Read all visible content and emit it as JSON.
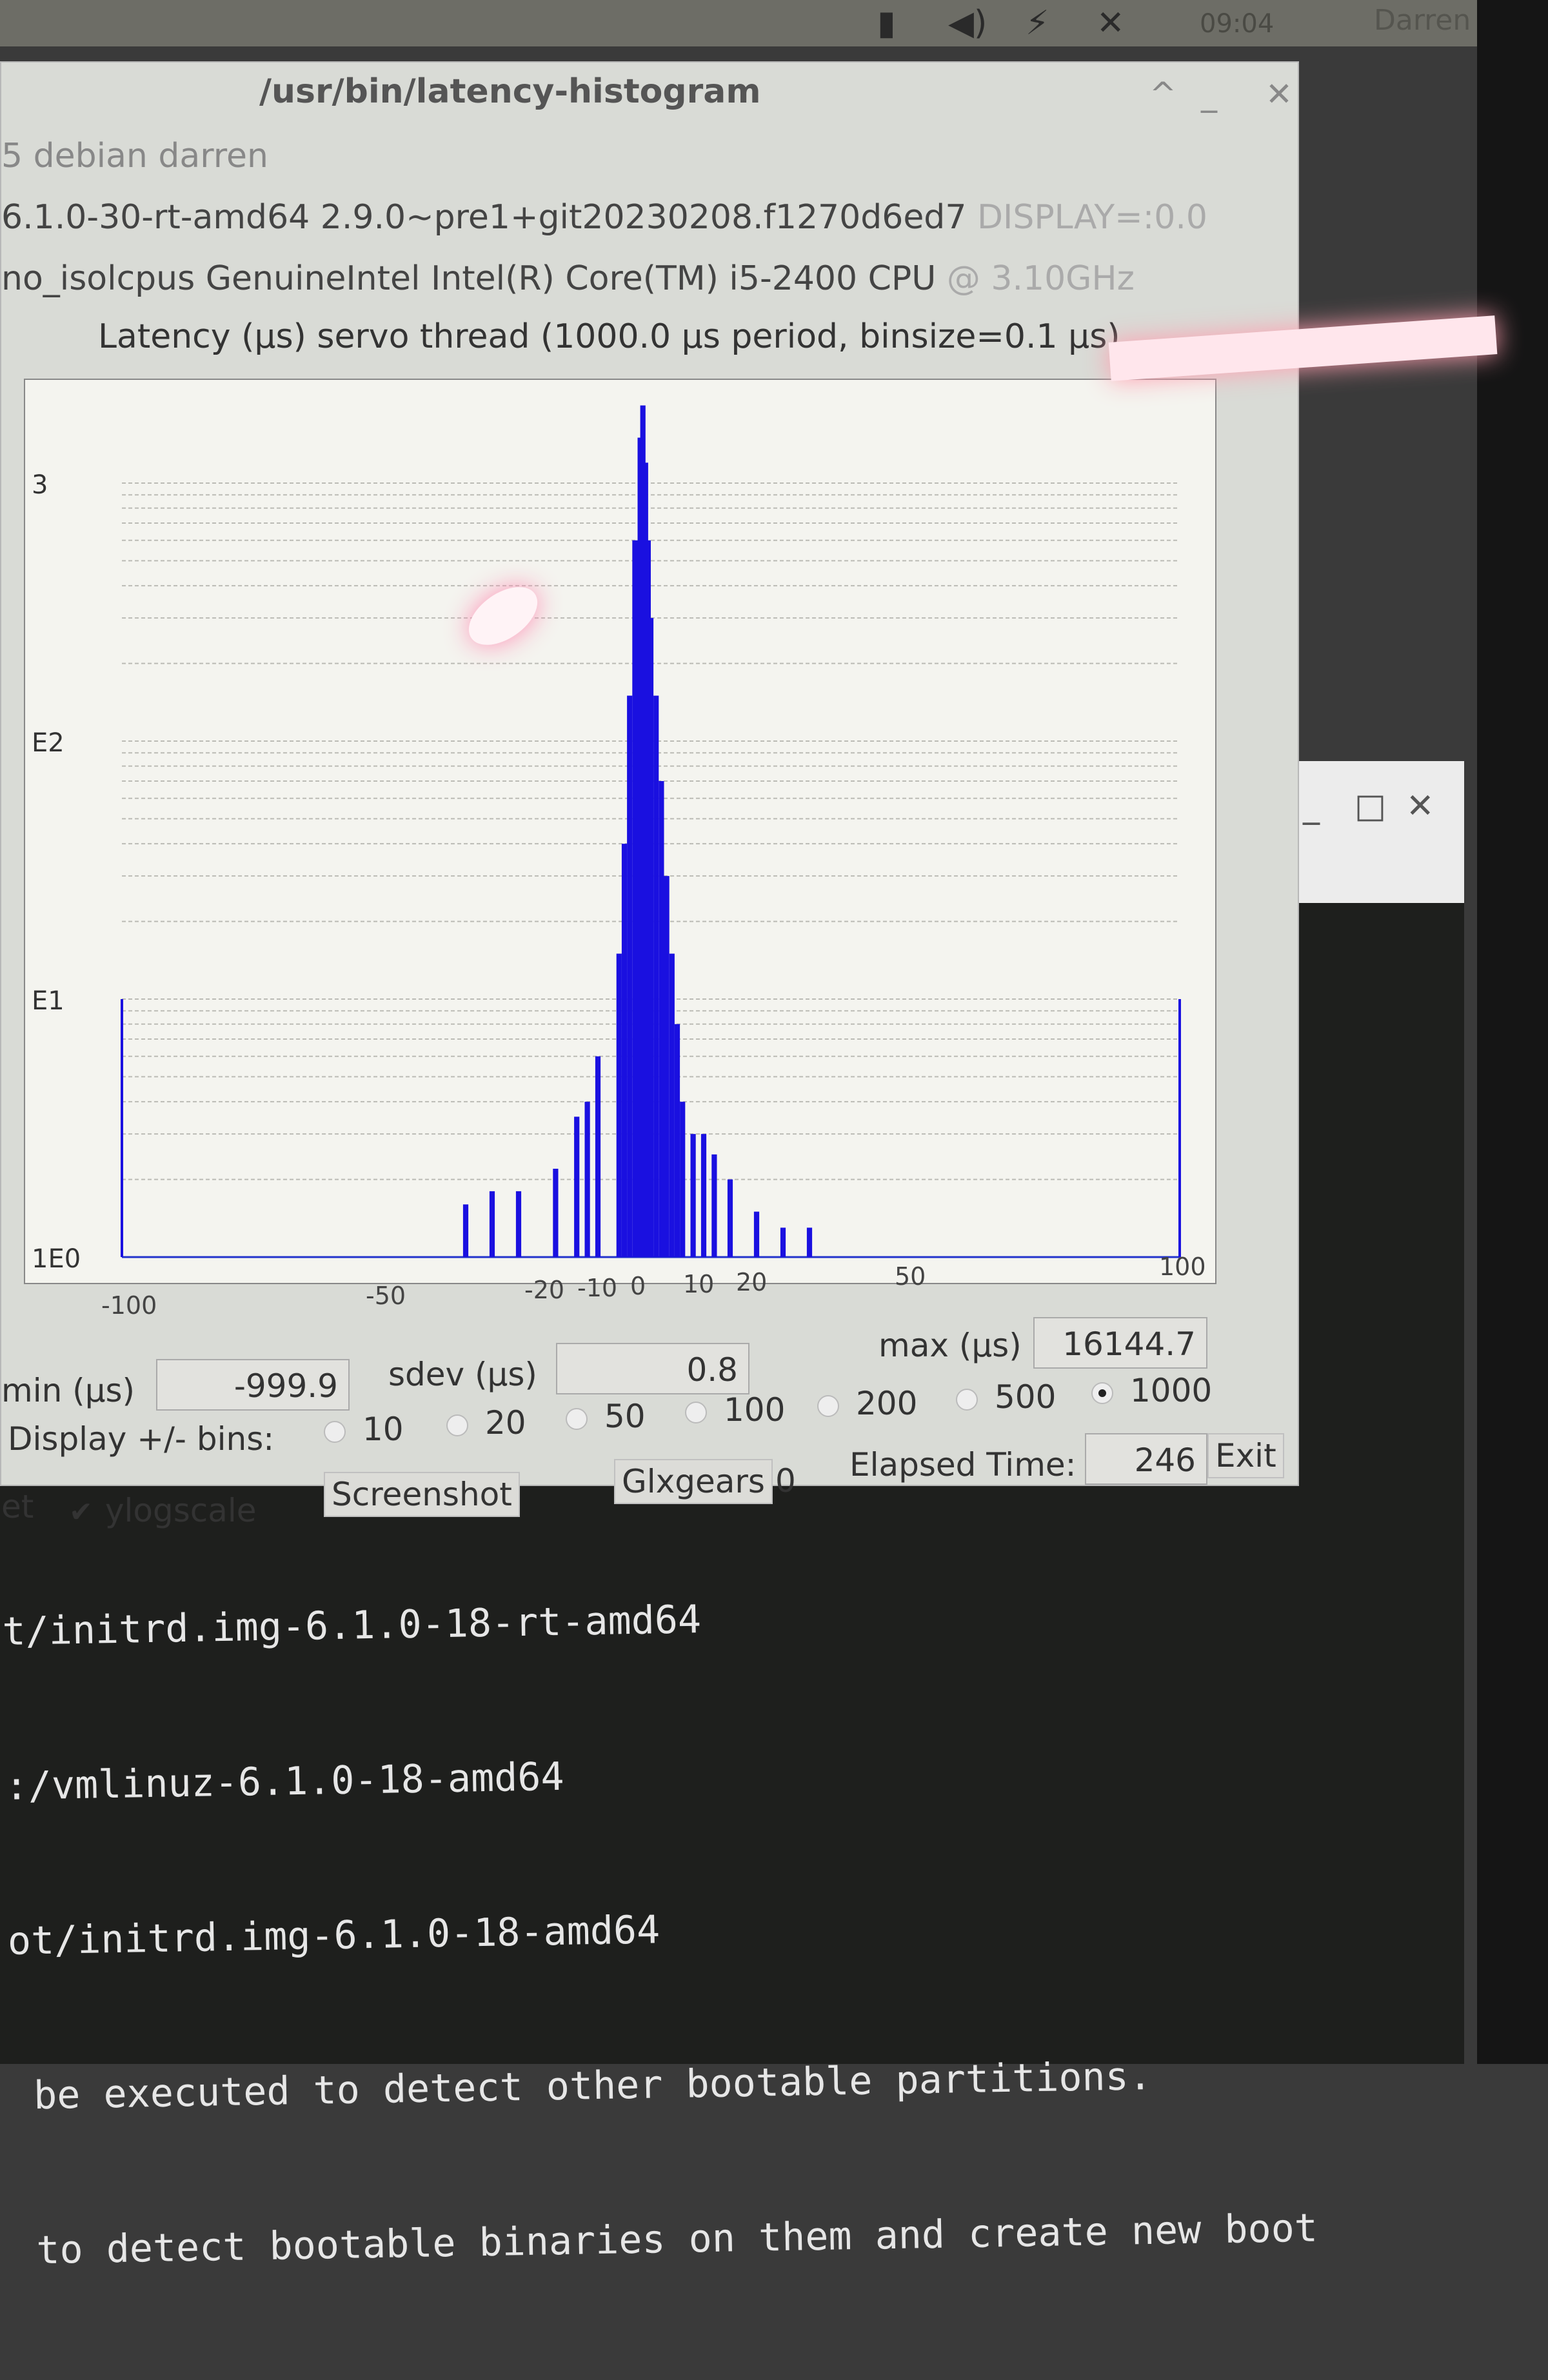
{
  "top_panel": {
    "clock": "09:04",
    "user": "Darren"
  },
  "window": {
    "title": "/usr/bin/latency-histogram",
    "user_line": "5 debian darren",
    "kernel_line_main": "6.1.0-30-rt-amd64  2.9.0~pre1+git20230208.f1270d6ed7",
    "kernel_line_display": "DISPLAY=:0.0",
    "cpu_line_main": "no_isolcpus   GenuineIntel  Intel(R) Core(TM) i5-2400 CPU",
    "cpu_line_freq": "@ 3.10GHz",
    "latency_line": "Latency (µs) servo thread (1000.0 µs period, binsize=0.1 µs)"
  },
  "chart_data": {
    "type": "bar",
    "ylog": true,
    "y_tick_labels": [
      "1E0",
      "E1",
      "E2",
      "3"
    ],
    "x_tick_labels": [
      "-100",
      "-50",
      "-20",
      "-10",
      "0",
      "10",
      "20",
      "50",
      "100"
    ],
    "x_ticks": [
      -100,
      -50,
      -20,
      -10,
      0,
      10,
      20,
      50,
      100
    ],
    "xlim": [
      -100,
      100
    ],
    "ylim_log10": [
      0,
      3.3
    ],
    "bins": [
      {
        "x": -100,
        "y": 10
      },
      {
        "x": -35,
        "y": 1.6
      },
      {
        "x": -30,
        "y": 1.8
      },
      {
        "x": -25,
        "y": 1.8
      },
      {
        "x": -18,
        "y": 2.2
      },
      {
        "x": -14,
        "y": 3.5
      },
      {
        "x": -12,
        "y": 4
      },
      {
        "x": -10,
        "y": 6
      },
      {
        "x": -6,
        "y": 15
      },
      {
        "x": -5,
        "y": 40
      },
      {
        "x": -4,
        "y": 150
      },
      {
        "x": -3,
        "y": 600
      },
      {
        "x": -2,
        "y": 1500
      },
      {
        "x": -1.5,
        "y": 2000
      },
      {
        "x": -1,
        "y": 1200
      },
      {
        "x": -0.5,
        "y": 600
      },
      {
        "x": 0,
        "y": 300
      },
      {
        "x": 1,
        "y": 150
      },
      {
        "x": 2,
        "y": 70
      },
      {
        "x": 3,
        "y": 30
      },
      {
        "x": 4,
        "y": 15
      },
      {
        "x": 5,
        "y": 8
      },
      {
        "x": 6,
        "y": 4
      },
      {
        "x": 8,
        "y": 3
      },
      {
        "x": 10,
        "y": 3
      },
      {
        "x": 12,
        "y": 2.5
      },
      {
        "x": 15,
        "y": 2
      },
      {
        "x": 20,
        "y": 1.5
      },
      {
        "x": 25,
        "y": 1.3
      },
      {
        "x": 30,
        "y": 1.3
      },
      {
        "x": 100,
        "y": 10
      }
    ]
  },
  "stats": {
    "min_label": "min (µs)",
    "min_value": "-999.9",
    "sdev_label": "sdev (µs)",
    "sdev_value": "0.8",
    "max_label": "max (µs)",
    "max_value": "16144.7"
  },
  "controls": {
    "display_label": "Display +/- bins:",
    "bin_options": [
      "10",
      "20",
      "50",
      "100",
      "200",
      "500",
      "1000"
    ],
    "selected_bins": "1000",
    "elapsed_label": "Elapsed Time:",
    "elapsed_value": "246",
    "exit_label": "Exit",
    "reset_label": "et",
    "ylogscale_label": "ylogscale",
    "screenshot_label": "Screenshot",
    "glxgears_label": "Glxgears",
    "glxgears_value": "0"
  },
  "terminal": {
    "lines": [
      "t/initrd.img-6.1.0-18-rt-amd64",
      ":/vmlinuz-6.1.0-18-amd64",
      "ot/initrd.img-6.1.0-18-amd64",
      " be executed to detect other bootable partitions.",
      " to detect bootable binaries on them and create new boot"
    ]
  }
}
